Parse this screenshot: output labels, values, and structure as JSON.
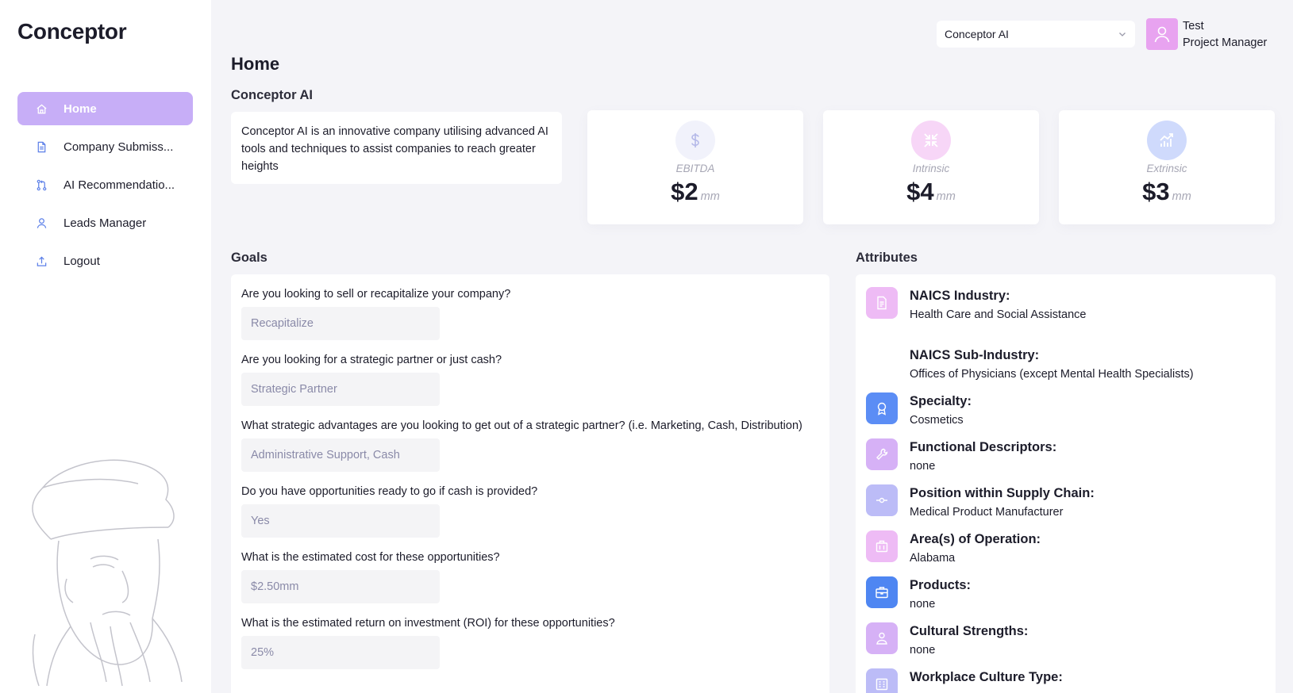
{
  "app": {
    "logo": "Conceptor"
  },
  "sidebar": {
    "items": [
      {
        "label": "Home",
        "icon": "home-icon"
      },
      {
        "label": "Company Submiss...",
        "icon": "document-icon"
      },
      {
        "label": "AI Recommendatio...",
        "icon": "branch-icon"
      },
      {
        "label": "Leads Manager",
        "icon": "user-icon"
      },
      {
        "label": "Logout",
        "icon": "upload-icon"
      }
    ]
  },
  "header": {
    "org_selected": "Conceptor AI",
    "user_name": "Test",
    "user_role": "Project Manager"
  },
  "main": {
    "page_title": "Home",
    "company_name": "Conceptor AI",
    "company_description": "Conceptor AI is an innovative company utilising advanced AI tools and techniques to assist companies to reach greater heights"
  },
  "metrics": [
    {
      "label": "EBITDA",
      "value": "$2",
      "unit": "mm",
      "icon": "dollar-icon",
      "color": "#eef0fb"
    },
    {
      "label": "Intrinsic",
      "value": "$4",
      "unit": "mm",
      "icon": "collapse-arrows-icon",
      "color": "#f6d5f6"
    },
    {
      "label": "Extrinsic",
      "value": "$3",
      "unit": "mm",
      "icon": "growth-chart-icon",
      "color": "#cdd8fb"
    }
  ],
  "goals": {
    "title": "Goals",
    "items": [
      {
        "question": "Are you looking to sell or recapitalize your company?",
        "answer": "Recapitalize"
      },
      {
        "question": "Are you looking for a strategic partner or just cash?",
        "answer": "Strategic Partner"
      },
      {
        "question": "What strategic advantages are you looking to get out of a strategic partner? (i.e. Marketing, Cash, Distribution)",
        "answer": "Administrative Support, Cash"
      },
      {
        "question": "Do you have opportunities ready to go if cash is provided?",
        "answer": "Yes"
      },
      {
        "question": "What is the estimated cost for these opportunities?",
        "answer": "$2.50mm"
      },
      {
        "question": "What is the estimated return on investment (ROI) for these opportunities?",
        "answer": "25%"
      }
    ]
  },
  "attributes": {
    "title": "Attributes",
    "items": [
      {
        "label": "NAICS Industry:",
        "value": "Health Care and Social Assistance",
        "icon": "file-icon",
        "color": "#ecb8f4"
      },
      {
        "label": "NAICS Sub-Industry:",
        "value": "Offices of Physicians (except Mental Health Specialists)",
        "icon": "",
        "color": ""
      },
      {
        "label": "Specialty:",
        "value": "Cosmetics",
        "icon": "award-icon",
        "color": "#5b8df5"
      },
      {
        "label": "Functional Descriptors:",
        "value": "none",
        "icon": "wrench-icon",
        "color": "#d3aef5"
      },
      {
        "label": "Position within Supply Chain:",
        "value": "Medical Product Manufacturer",
        "icon": "node-icon",
        "color": "#b9b9f7"
      },
      {
        "label": "Area(s) of Operation:",
        "value": "Alabama",
        "icon": "building-icon",
        "color": "#ecb8f4"
      },
      {
        "label": "Products:",
        "value": "none",
        "icon": "briefcase-icon",
        "color": "#4e86f2"
      },
      {
        "label": "Cultural Strengths:",
        "value": "none",
        "icon": "people-icon",
        "color": "#d3aef5"
      },
      {
        "label": "Workplace Culture Type:",
        "value": "",
        "icon": "office-icon",
        "color": "#b9b9f7"
      }
    ]
  }
}
